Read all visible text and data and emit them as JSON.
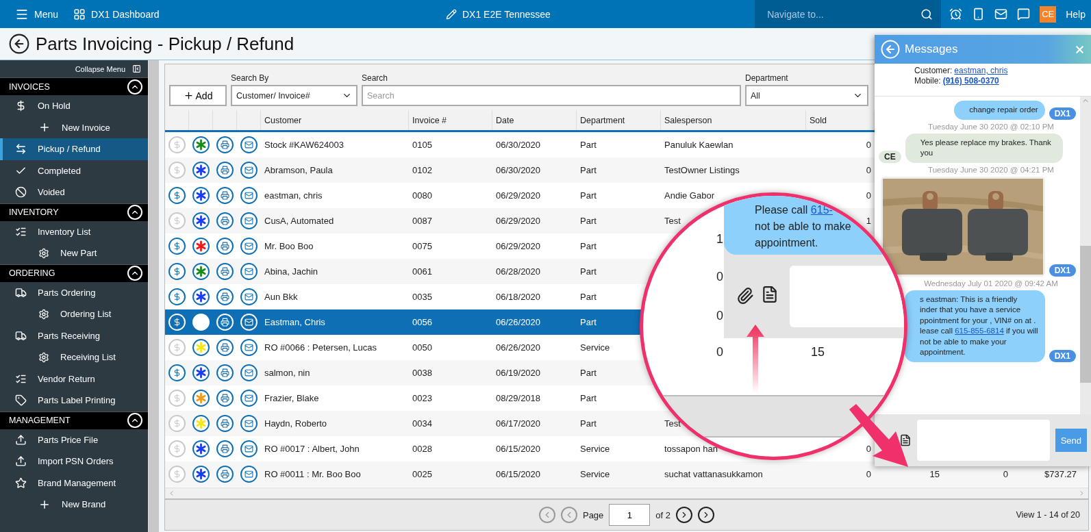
{
  "top_bar": {
    "menu": "Menu",
    "dashboard": "DX1 Dashboard",
    "store": "DX1 E2E Tennessee",
    "search": {
      "placeholder": "Navigate to..."
    },
    "user": "CE",
    "help": "Help"
  },
  "page_title": "Parts Invoicing - Pickup / Refund",
  "sidebar": {
    "collapse": "Collapse Menu",
    "sections": [
      {
        "title": "INVOICES",
        "expanded": true,
        "items": [
          {
            "label": "On Hold",
            "selected": false,
            "children": [
              {
                "label": "New Invoice",
                "selected": false
              }
            ]
          },
          {
            "label": "Pickup / Refund",
            "selected": true
          },
          {
            "label": "Completed",
            "selected": false
          },
          {
            "label": "Voided",
            "selected": false
          }
        ]
      },
      {
        "title": "INVENTORY",
        "expanded": true,
        "items": [
          {
            "label": "Inventory List",
            "selected": false,
            "children": [
              {
                "label": "New Part",
                "selected": false
              }
            ]
          }
        ]
      },
      {
        "title": "ORDERING",
        "expanded": true,
        "items": [
          {
            "label": "Parts Ordering",
            "selected": false,
            "children": [
              {
                "label": "Ordering List",
                "selected": false
              }
            ]
          },
          {
            "label": "Parts Receiving",
            "selected": false,
            "children": [
              {
                "label": "Receiving List",
                "selected": false
              }
            ]
          },
          {
            "label": "Vendor Return",
            "selected": false
          },
          {
            "label": "Parts Label Printing",
            "selected": false
          }
        ]
      },
      {
        "title": "MANAGEMENT",
        "expanded": true,
        "items": [
          {
            "label": "Parts Price File",
            "selected": false
          },
          {
            "label": "Import PSN Orders",
            "selected": false
          },
          {
            "label": "Brand Management",
            "selected": false,
            "children": [
              {
                "label": "New Brand",
                "selected": false
              }
            ]
          }
        ]
      }
    ]
  },
  "toolbar": {
    "add": "Add",
    "search_by": {
      "label": "Search By",
      "value": "Customer/ Invoice#"
    },
    "search": {
      "label": "Search",
      "placeholder": "Search"
    },
    "department": {
      "label": "Department",
      "value": "All"
    }
  },
  "table": {
    "columns": [
      "Customer",
      "Invoice #",
      "Date",
      "Department",
      "Salesperson",
      "Sold"
    ],
    "rows": [
      {
        "customer": "Stock #KAW624003",
        "invoice": "0105",
        "date": "06/30/2020",
        "department": "Part",
        "salesperson": "Panuluk Kaewlan",
        "sold": "0",
        "payable": false,
        "color": "#1a8a1a",
        "selected": false
      },
      {
        "customer": "Abramson, Paula",
        "invoice": "0102",
        "date": "06/30/2020",
        "department": "Part",
        "salesperson": "TestOwner Listings",
        "sold": "0",
        "payable": false,
        "color": "#1a3cf0",
        "selected": false
      },
      {
        "customer": "eastman, chris",
        "invoice": "0080",
        "date": "06/29/2020",
        "department": "Part",
        "salesperson": "Andie Gabor",
        "sold": "0",
        "payable": true,
        "color": "#1a3cf0",
        "selected": false
      },
      {
        "customer": "CusA, Automated",
        "invoice": "0087",
        "date": "06/29/2020",
        "department": "Part",
        "salesperson": "Test",
        "sold": "1",
        "payable": false,
        "color": "#1a3cf0",
        "selected": false
      },
      {
        "customer": "Mr. Boo Boo",
        "invoice": "0075",
        "date": "06/29/2020",
        "department": "Part",
        "payable": true,
        "color": "#f01a1a",
        "selected": false
      },
      {
        "customer": "Abina, Jachin",
        "invoice": "0061",
        "date": "06/28/2020",
        "department": "Part",
        "payable": true,
        "color": "#1a8a1a",
        "selected": false
      },
      {
        "customer": "Aun Bkk",
        "invoice": "0035",
        "date": "06/18/2020",
        "department": "Part",
        "payable": true,
        "color": "#1a3cf0",
        "selected": false
      },
      {
        "customer": "Eastman, Chris",
        "invoice": "0056",
        "date": "06/26/2020",
        "department": "Part",
        "payable": true,
        "color": "#ffffff",
        "selected": true
      },
      {
        "customer": "RO #0066 : Petersen, Lucas",
        "invoice": "0050",
        "date": "06/26/2020",
        "department": "Service",
        "payable": false,
        "color": "#f5e61a",
        "selected": false
      },
      {
        "customer": "salmon, nin",
        "invoice": "0038",
        "date": "06/19/2020",
        "department": "Part",
        "payable": true,
        "color": "#1a3cf0",
        "selected": false
      },
      {
        "customer": "Frazier, Blake",
        "invoice": "0023",
        "date": "08/29/2018",
        "department": "Part",
        "payable": false,
        "color": "#f59a1a",
        "selected": false
      },
      {
        "customer": "Haydn, Roberto",
        "invoice": "0034",
        "date": "06/17/2020",
        "department": "Part",
        "salesperson": "Test",
        "payable": false,
        "color": "#f5e61a",
        "selected": false
      },
      {
        "customer": "RO #0017 : Albert, John",
        "invoice": "0028",
        "date": "06/15/2020",
        "department": "Service",
        "salesperson": "tossapon han",
        "sold": "0",
        "payable": false,
        "color": "#1a3cf0",
        "selected": false
      },
      {
        "customer": "RO #0011 : Mr. Boo Boo",
        "invoice": "0025",
        "date": "06/15/2020",
        "department": "Service",
        "salesperson": "suchat vattanasukkamon",
        "sold": "0",
        "column_11": "15",
        "column_12": "0",
        "column_13": "$737.27",
        "payable": false,
        "color": "#1a3cf0",
        "selected": false
      }
    ]
  },
  "pager": {
    "page_label": "Page",
    "page": "1",
    "of": "of 2",
    "view": "View 1 - 14 of 20"
  },
  "messages": {
    "title": "Messages",
    "customer_label": "Customer:",
    "customer": "eastman, chris",
    "mobile_label": "Mobile:",
    "mobile": "(916) 508-0370",
    "items": [
      {
        "kind": "text",
        "outgoing": true,
        "badge": "DX1",
        "lines": [
          {
            "text": "change repair order"
          }
        ]
      },
      {
        "kind": "text",
        "outgoing": false,
        "timestamp": "Tuesday June 30 2020 @ 02:10 PM",
        "badge": "CE",
        "lines": [
          {
            "text": "Yes please replace my brakes. Thank you"
          }
        ]
      },
      {
        "kind": "picture",
        "outgoing": true,
        "timestamp": "Tuesday June 30 2020 @ 04:21 PM",
        "badge": "DX1"
      },
      {
        "kind": "text",
        "outgoing": true,
        "timestamp": "Wednesday July 01 2020 @ 09:42 AM",
        "badge": "DX1",
        "lines": [
          {
            "text": "s eastman: This is a friendly"
          },
          {
            "text": "inder that you have a service"
          },
          {
            "text": "ppointment for your , VIN# on at ."
          },
          {
            "text": "lease call ",
            "link": "615-855-6814",
            "after": " if you will"
          },
          {
            "text": "not be able to make your"
          },
          {
            "text": "appointment."
          }
        ]
      }
    ],
    "send": "Send"
  },
  "magnifier": {
    "message": {
      "text": "Please call ",
      "link": "615-"
    },
    "message_lines": [
      "not be able to make",
      "appointment."
    ],
    "numbers": [
      "1",
      "0",
      "0",
      "0"
    ],
    "value": "15"
  }
}
